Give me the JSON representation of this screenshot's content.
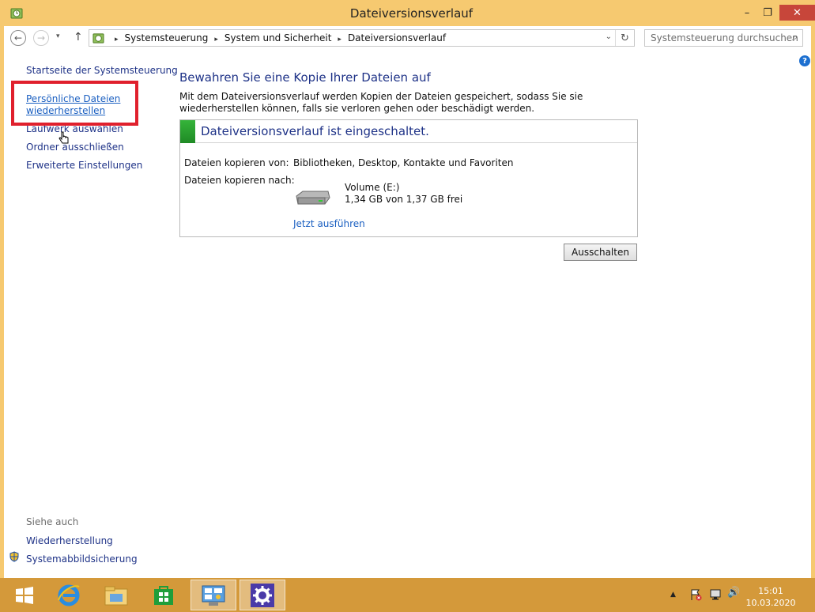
{
  "window": {
    "title": "Dateiversionsverlauf",
    "minimize_glyph": "–",
    "maximize_glyph": "❐",
    "close_glyph": "✕"
  },
  "nav": {
    "back_glyph": "←",
    "forward_glyph": "→",
    "recent_glyph": "▾",
    "up_glyph": "↑",
    "breadcrumbs": [
      "Systemsteuerung",
      "System und Sicherheit",
      "Dateiversionsverlauf"
    ],
    "crumb_sep": "▸",
    "refresh_glyph": "↻",
    "dropdown_glyph": "⌄",
    "search_placeholder": "Systemsteuerung durchsuchen",
    "search_glyph": "⌕"
  },
  "help_glyph": "?",
  "left": {
    "home": "Startseite der Systemsteuerung",
    "restore_line1": "Persönliche Dateien",
    "restore_line2": "wiederherstellen",
    "select_drive": "Laufwerk auswählen",
    "exclude": "Ordner ausschließen",
    "advanced": "Erweiterte Einstellungen",
    "see_also": "Siehe auch",
    "recovery": "Wiederherstellung",
    "image_backup": "Systemabbildsicherung"
  },
  "main": {
    "heading": "Bewahren Sie eine Kopie Ihrer Dateien auf",
    "desc": "Mit dem Dateiversionsverlauf werden Kopien der Dateien gespeichert, sodass Sie sie wiederherstellen können, falls sie verloren gehen oder beschädigt werden.",
    "status": "Dateiversionsverlauf ist eingeschaltet.",
    "copy_from_label": "Dateien kopieren von:",
    "copy_from_value": "Bibliotheken, Desktop, Kontakte und Favoriten",
    "copy_to_label": "Dateien kopieren nach:",
    "drive_name": "Volume (E:)",
    "drive_space": "1,34 GB von 1,37 GB frei",
    "run_now": "Jetzt ausführen",
    "turn_off": "Ausschalten"
  },
  "taskbar": {
    "time": "15:01",
    "date": "10.03.2020",
    "tray_arrow": "▲",
    "volume_glyph": "🔊"
  },
  "colors": {
    "accent": "#f6c970",
    "taskbar": "#d4993a",
    "link": "#1e3287",
    "highlight": "#e0202d"
  }
}
